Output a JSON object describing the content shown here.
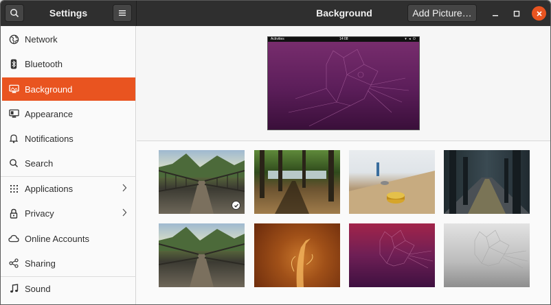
{
  "header": {
    "settings_title": "Settings",
    "page_title": "Background",
    "add_picture_label": "Add Picture…"
  },
  "sidebar": {
    "items": [
      {
        "label": "Network",
        "icon": "network-icon"
      },
      {
        "label": "Bluetooth",
        "icon": "bluetooth-icon"
      },
      {
        "label": "Background",
        "icon": "background-icon",
        "active": true
      },
      {
        "label": "Appearance",
        "icon": "appearance-icon"
      },
      {
        "label": "Notifications",
        "icon": "bell-icon"
      },
      {
        "label": "Search",
        "icon": "search-icon"
      },
      {
        "label": "Applications",
        "icon": "applications-icon",
        "chevron": true
      },
      {
        "label": "Privacy",
        "icon": "lock-icon",
        "chevron": true
      },
      {
        "label": "Online Accounts",
        "icon": "cloud-icon"
      },
      {
        "label": "Sharing",
        "icon": "share-icon"
      },
      {
        "label": "Sound",
        "icon": "music-note-icon"
      }
    ]
  },
  "preview": {
    "activities": "Activities",
    "clock": "14:08"
  },
  "wallpapers": [
    {
      "name": "bridge",
      "selected": true
    },
    {
      "name": "forest-lake"
    },
    {
      "name": "table-tops"
    },
    {
      "name": "subway"
    },
    {
      "name": "bridge-2"
    },
    {
      "name": "orange-fox"
    },
    {
      "name": "purple-fossa"
    },
    {
      "name": "grey-fossa"
    }
  ],
  "colors": {
    "accent": "#e95420",
    "header_bg": "#2f2f2f"
  }
}
